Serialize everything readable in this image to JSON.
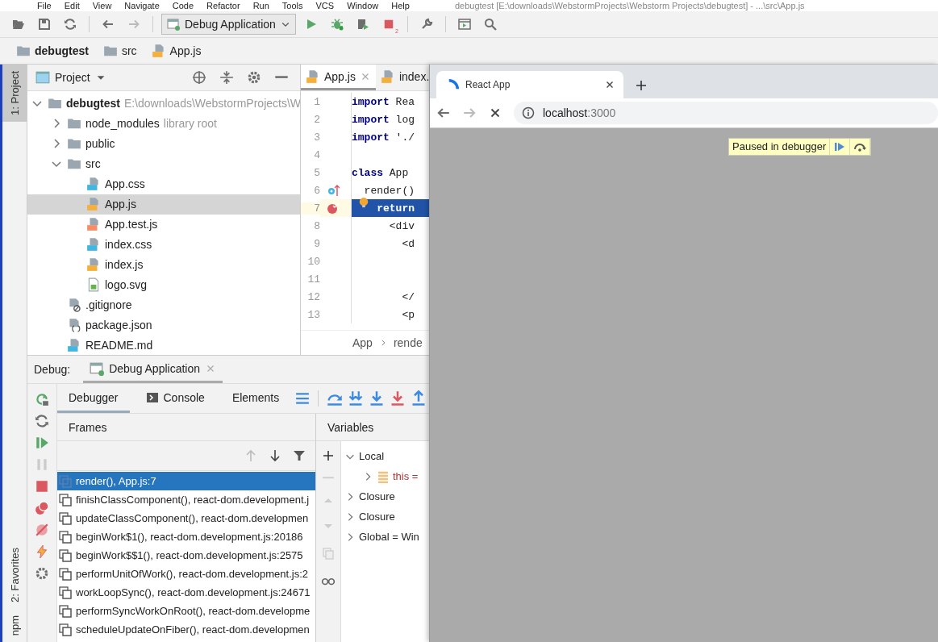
{
  "menu": [
    "File",
    "Edit",
    "View",
    "Navigate",
    "Code",
    "Refactor",
    "Run",
    "Tools",
    "VCS",
    "Window",
    "Help"
  ],
  "title": "debugtest [E:\\downloads\\WebstormProjects\\Webstorm Projects\\debugtest] - ...\\src\\App.js",
  "toolbar": {
    "run_config": "Debug Application",
    "stop_badge": "2"
  },
  "breadcrumb": [
    {
      "label": "debugtest",
      "kind": "folder",
      "bold": true
    },
    {
      "label": "src",
      "kind": "folder",
      "bold": false
    },
    {
      "label": "App.js",
      "kind": "js",
      "bold": false
    }
  ],
  "stripe_top": [
    {
      "label": "1: Project",
      "selected": true
    }
  ],
  "stripe_bottom": [
    {
      "label": "2: Favorites",
      "selected": false
    },
    {
      "label": "npm",
      "selected": false
    }
  ],
  "project": {
    "title": "Project",
    "tree": [
      {
        "label": "debugtest",
        "kind": "folder",
        "hint": "E:\\downloads\\WebstormProjects\\W",
        "expanded": true,
        "selected": false,
        "children": [
          {
            "label": "node_modules",
            "kind": "folder",
            "hint": "library root",
            "expanded": false,
            "selected": false
          },
          {
            "label": "public",
            "kind": "folder",
            "expanded": false,
            "selected": false
          },
          {
            "label": "src",
            "kind": "folder",
            "expanded": true,
            "selected": false,
            "children": [
              {
                "label": "App.css",
                "kind": "css",
                "selected": false
              },
              {
                "label": "App.js",
                "kind": "js",
                "selected": true
              },
              {
                "label": "App.test.js",
                "kind": "testjs",
                "selected": false
              },
              {
                "label": "index.css",
                "kind": "css",
                "selected": false
              },
              {
                "label": "index.js",
                "kind": "js",
                "selected": false
              },
              {
                "label": "logo.svg",
                "kind": "svg",
                "selected": false
              }
            ]
          },
          {
            "label": ".gitignore",
            "kind": "gitignore",
            "selected": false
          },
          {
            "label": "package.json",
            "kind": "json",
            "selected": false
          },
          {
            "label": "README.md",
            "kind": "md",
            "selected": false
          }
        ]
      }
    ]
  },
  "editor": {
    "tabs": [
      {
        "label": "App.js",
        "kind": "js",
        "selected": true,
        "closable": true
      },
      {
        "label": "index.",
        "kind": "js",
        "selected": false,
        "closable": false
      }
    ],
    "lines": [
      {
        "number": "1",
        "kind": "plain",
        "keyword": "import",
        "text": " Rea",
        "current": false
      },
      {
        "number": "2",
        "kind": "plain",
        "keyword": "import",
        "text": " log",
        "current": false
      },
      {
        "number": "3",
        "kind": "plain",
        "keyword": "import",
        "text": " './",
        "current": false
      },
      {
        "number": "4",
        "kind": "plain",
        "current": false
      },
      {
        "number": "5",
        "kind": "plain",
        "keyword": "class",
        "text": " App",
        "current": false
      },
      {
        "number": "6",
        "kind": "override",
        "text": "  render()",
        "current": false
      },
      {
        "number": "7",
        "kind": "breakpoint",
        "keyword": "    return",
        "current": true
      },
      {
        "number": "8",
        "kind": "plain",
        "text": "      <div",
        "current": false
      },
      {
        "number": "9",
        "kind": "plain",
        "text": "        <d",
        "current": false
      },
      {
        "number": "10",
        "kind": "plain",
        "current": false
      },
      {
        "number": "11",
        "kind": "plain",
        "current": false
      },
      {
        "number": "12",
        "kind": "plain",
        "text": "        </",
        "current": false
      },
      {
        "number": "13",
        "kind": "plain",
        "text": "        <p",
        "current": false
      }
    ],
    "breadcrumb": [
      "App",
      "rende"
    ]
  },
  "debug": {
    "label": "Debug:",
    "session": "Debug Application",
    "tabs": [
      {
        "label": "Debugger",
        "kind": "plain",
        "selected": true
      },
      {
        "label": "Console",
        "kind": "console",
        "selected": false
      },
      {
        "label": "Elements",
        "kind": "plain",
        "selected": false
      }
    ],
    "frames_title": "Frames",
    "frames": [
      {
        "label": "render(), App.js:7",
        "selected": true
      },
      {
        "label": "finishClassComponent(), react-dom.development.j",
        "selected": false
      },
      {
        "label": "updateClassComponent(), react-dom.developmen",
        "selected": false
      },
      {
        "label": "beginWork$1(), react-dom.development.js:20186",
        "selected": false
      },
      {
        "label": "beginWork$$1(), react-dom.development.js:2575",
        "selected": false
      },
      {
        "label": "performUnitOfWork(), react-dom.development.js:2",
        "selected": false
      },
      {
        "label": "workLoopSync(), react-dom.development.js:24671",
        "selected": false
      },
      {
        "label": "performSyncWorkOnRoot(), react-dom.developme",
        "selected": false
      },
      {
        "label": "scheduleUpdateOnFiber(), react-dom.developmen",
        "selected": false
      }
    ],
    "variables_title": "Variables",
    "variables": [
      {
        "label": "Local",
        "expanded": true,
        "children": [
          {
            "label": "this =",
            "expanded": false,
            "kind": "object"
          }
        ]
      },
      {
        "label": "Closure",
        "expanded": false
      },
      {
        "label": "Closure",
        "expanded": false
      },
      {
        "label": "Global = Win",
        "expanded": false
      }
    ]
  },
  "browser": {
    "tab_title": "React App",
    "host": "localhost",
    "port": ":3000",
    "banner": "Paused in debugger"
  }
}
